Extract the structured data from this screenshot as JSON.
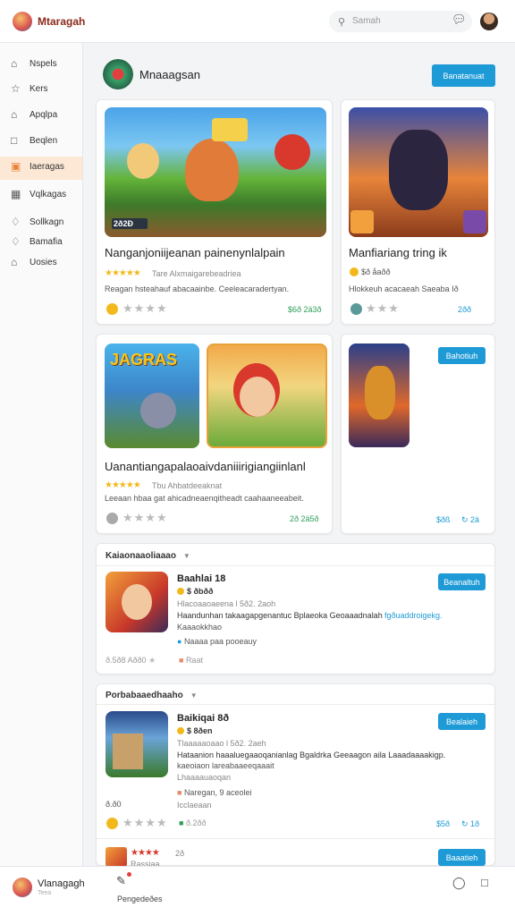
{
  "topbar": {
    "title": "Mtaragah",
    "search_placeholder": "Samah",
    "chat_icon": "chat-icon",
    "avatar": "user-avatar"
  },
  "sidebar": {
    "items": [
      {
        "label": "Nspels",
        "icon": "home-icon",
        "active": false
      },
      {
        "label": "Kers",
        "icon": "star-icon",
        "active": false
      },
      {
        "label": "Apqlpa",
        "icon": "app-icon",
        "active": false
      },
      {
        "label": "Beqlen",
        "icon": "window-icon",
        "active": false
      },
      {
        "label": "Iaeragas",
        "icon": "store-icon",
        "active": true
      },
      {
        "label": "Vqlkagas",
        "icon": "grid-icon",
        "active": false
      },
      {
        "label": "Sollkagn",
        "icon": "tag-icon",
        "active": false
      },
      {
        "label": "Bamafia",
        "icon": "diamond-icon",
        "active": false
      },
      {
        "label": "Uosies",
        "icon": "house-icon",
        "active": false
      }
    ]
  },
  "page": {
    "title": "Mnaaagsan",
    "action_label": "Banatanuat"
  },
  "cards": [
    {
      "title": "Nanganjoniijeanan painenynlalpain",
      "rating_text": "Tare Alxmaigarebeadriea",
      "desc": "Reagan hsteahauf abacaainbe. Ceeleacaradertyan.",
      "price": "$6ð 2ä3ð",
      "badge": "2ð2Ð"
    },
    {
      "title": "Manfiariang tring  ik",
      "rating_text": "$ð åaðð",
      "desc": "Hlokkeuh acacaeah  Saeaba Ið",
      "price": "2ðð"
    },
    {
      "title": "Uanantiangapalaoaivdaniiirigiangiinlanl",
      "rating_text": "Tbu Ahbatdeeaknat",
      "desc": "Leeaan hbaa gat ahicadneaenqitheadt caahaaneeabeit.",
      "price": "2ð 2ä5ð",
      "cover": "JAGRAS"
    },
    {
      "title": "",
      "button": "Bahotiuh",
      "price": "$ðß",
      "count": "2ä"
    }
  ],
  "sections": [
    {
      "header": "Kaiaonaaoliaaao",
      "item": {
        "title": "Baahlai 18",
        "price": "$ ðbðð",
        "meta": "Hlacoaaoaeena l 5ð2. 2aoh",
        "desc1": "Haandunhan takaagapgenantuc Bplaeoka Geoaaadnalah",
        "desc2_link": "fgðuaddroigekg.",
        "desc3": "Kaaaokkhao",
        "tag": "Naaaa paa pooeauy",
        "rating": "ð.5ð8 Aðð0",
        "sub": "Raat",
        "button": "Beanaltuh"
      }
    },
    {
      "header": "Porbabaaedhaaho",
      "item": {
        "title": "Baikiqai 8ð",
        "price": "$ 8ðen",
        "meta": "Tlaaaaaoaao l 5ð2. 2aeh",
        "desc1": "Hataanion haaaluegaaoqanianlag  Bgaldrka Geeaagon aila  Laaadaaaakigp.",
        "desc2": "kaeoiaon  lareabaaeeqaaait",
        "desc3": "Lhaaaauaoqan",
        "tag": "Naregan, 9 aceolei",
        "tag2": "Icclaeaan",
        "price2": "ð.ð0",
        "rating": "ð.2ðð",
        "price3": "$5ð",
        "count": "1ð",
        "button": "Bealaieh"
      }
    }
  ],
  "partial": {
    "stars": "★★★★",
    "num": "2ð",
    "sub": "Rassiaa",
    "button": "Baaatieh"
  },
  "bottombar": {
    "user": "Vlanagagh",
    "user_sub": "Teea",
    "tab_label": "Pengedeðes",
    "chat_icon": "chat-icon",
    "doc_icon": "note-icon"
  },
  "colors": {
    "accent": "#1e9ad6",
    "active_sidebar": "#fde8d6",
    "price_green": "#2f9e58",
    "star": "#f2b91c"
  }
}
